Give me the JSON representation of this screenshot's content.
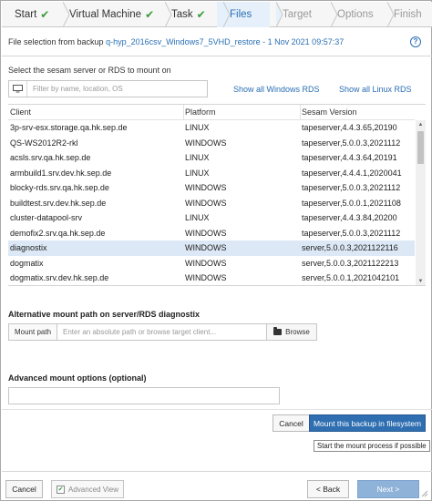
{
  "wizard": {
    "steps": [
      {
        "label": "Start",
        "state": "done"
      },
      {
        "label": "Virtual Machine",
        "state": "done"
      },
      {
        "label": "Task",
        "state": "done"
      },
      {
        "label": "Files",
        "state": "active"
      },
      {
        "label": "Target",
        "state": "todo"
      },
      {
        "label": "Options",
        "state": "todo"
      },
      {
        "label": "Finish",
        "state": "todo"
      }
    ],
    "check_glyph": "✔"
  },
  "file_selection": {
    "prefix": "File selection from backup",
    "backup_name": "q-hyp_2016csv_Windows7_5VHD_restore - 1 Nov 2021 09:57:37",
    "help_glyph": "?"
  },
  "server_select": {
    "title": "Select the sesam server or RDS to mount on",
    "filter_placeholder": "Filter by name, location, OS",
    "show_all_windows": "Show all Windows RDS",
    "show_all_linux": "Show all Linux RDS"
  },
  "table": {
    "columns": [
      "Client",
      "Platform",
      "Sesam Version"
    ],
    "rows": [
      {
        "client": "3p-srv-esx.storage.qa.hk.sep.de",
        "platform": "LINUX",
        "version": "tapeserver,4.4.3.65,20190"
      },
      {
        "client": "QS-WS2012R2-rkl",
        "platform": "WINDOWS",
        "version": "tapeserver,5.0.0.3,2021112"
      },
      {
        "client": "acsls.srv.qa.hk.sep.de",
        "platform": "LINUX",
        "version": "tapeserver,4.4.3.64,20191"
      },
      {
        "client": "armbuild1.srv.dev.hk.sep.de",
        "platform": "LINUX",
        "version": "tapeserver,4.4.4.1,2020041"
      },
      {
        "client": "blocky-rds.srv.qa.hk.sep.de",
        "platform": "WINDOWS",
        "version": "tapeserver,5.0.0.3,2021112"
      },
      {
        "client": "buildtest.srv.dev.hk.sep.de",
        "platform": "WINDOWS",
        "version": "tapeserver,5.0.0.1,2021108"
      },
      {
        "client": "cluster-datapool-srv",
        "platform": "LINUX",
        "version": "tapeserver,4.4.3.84,20200"
      },
      {
        "client": "demofix2.srv.qa.hk.sep.de",
        "platform": "WINDOWS",
        "version": "tapeserver,5.0.0.3,2021112"
      },
      {
        "client": "diagnostix",
        "platform": "WINDOWS",
        "version": "server,5.0.0.3,2021122116",
        "selected": true
      },
      {
        "client": "dogmatix",
        "platform": "WINDOWS",
        "version": "server,5.0.0.3,2021122213"
      },
      {
        "client": "dogmatix.srv.dev.hk.sep.de",
        "platform": "WINDOWS",
        "version": "server,5.0.0.1,2021042101"
      }
    ]
  },
  "alt_mount": {
    "title": "Alternative mount path on server/RDS diagnostix",
    "label": "Mount path",
    "placeholder": "Enter an absolute path or browse target client...",
    "browse_label": "Browse"
  },
  "advanced": {
    "title": "Advanced mount options (optional)",
    "value": ""
  },
  "actions": {
    "cancel_label": "Cancel",
    "mount_label": "Mount this backup in filesystem",
    "tooltip": "Start the mount process if possible"
  },
  "footer": {
    "cancel_label": "Cancel",
    "advanced_view_label": "Advanced View",
    "back_label": "< Back",
    "next_label": "Next >"
  },
  "colors": {
    "accent": "#2a6fb5",
    "check": "#3a9a3a",
    "selected_row": "#dce8f5",
    "primary_button": "#2f6fb1"
  }
}
